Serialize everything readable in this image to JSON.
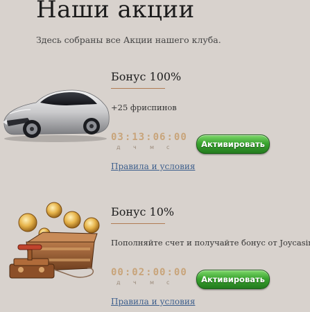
{
  "page": {
    "title": "Наши акции",
    "subtitle": "Здесь собраны все Акции нашего клуба."
  },
  "promotions": [
    {
      "image_icon": "sports-car-icon",
      "title": "Бонус 100%",
      "description": "+25 фриспинов",
      "countdown": {
        "days": "03",
        "hours": "13",
        "minutes": "06",
        "seconds": "00"
      },
      "countdown_units": [
        "д",
        "ч",
        "м",
        "с"
      ],
      "button_label": "Активировать",
      "rules_link": "Правила и условия"
    },
    {
      "image_icon": "treasure-chest-coins-icon",
      "title": "Бонус 10%",
      "description": "Пополняйте счет и получайте бонус от Joycasino",
      "countdown": {
        "days": "00",
        "hours": "02",
        "minutes": "00",
        "seconds": "00"
      },
      "countdown_units": [
        "д",
        "ч",
        "м",
        "с"
      ],
      "button_label": "Активировать",
      "rules_link": "Правила и условия"
    }
  ],
  "colors": {
    "background": "#d8d2cd",
    "countdown": "#c8a47a",
    "button": "#3aa530",
    "link": "#3c5e8c",
    "underline": "#b07a52"
  }
}
